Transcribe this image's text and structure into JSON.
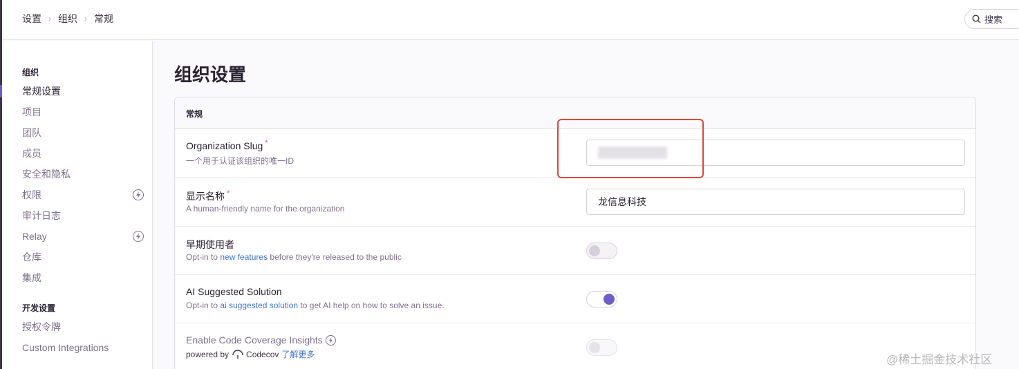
{
  "breadcrumb": [
    "设置",
    "组织",
    "常规"
  ],
  "search": {
    "label": "搜索"
  },
  "sidebar": {
    "section_org": "组织",
    "org_items": [
      {
        "label": "常规设置",
        "active": true,
        "badge": false
      },
      {
        "label": "项目",
        "active": false,
        "badge": false
      },
      {
        "label": "团队",
        "active": false,
        "badge": false
      },
      {
        "label": "成员",
        "active": false,
        "badge": false
      },
      {
        "label": "安全和隐私",
        "active": false,
        "badge": false
      },
      {
        "label": "权限",
        "active": false,
        "badge": true
      },
      {
        "label": "审计日志",
        "active": false,
        "badge": false
      },
      {
        "label": "Relay",
        "active": false,
        "badge": true
      },
      {
        "label": "仓库",
        "active": false,
        "badge": false
      },
      {
        "label": "集成",
        "active": false,
        "badge": false
      }
    ],
    "section_dev": "开发设置",
    "dev_items": [
      {
        "label": "授权令牌"
      },
      {
        "label": "Custom Integrations"
      }
    ]
  },
  "main": {
    "title": "组织设置",
    "panel_title": "常规",
    "fields": {
      "slug": {
        "label": "Organization Slug",
        "required": "*",
        "help": "一个用于认证该组织的唯一ID",
        "value": ""
      },
      "name": {
        "label": "显示名称",
        "required": "*",
        "help": "A human-friendly name for the organization",
        "value": "龙信息科技"
      },
      "early": {
        "label": "早期使用者",
        "help_pre": "Opt-in to ",
        "help_link": "new features",
        "help_post": " before they're released to the public",
        "enabled": false
      },
      "ai": {
        "label": "AI Suggested Solution",
        "help_pre": "Opt-in to ",
        "help_link": "ai suggested solution",
        "help_post": " to get AI help on how to solve an issue.",
        "enabled": true
      },
      "coverage": {
        "label": "Enable Code Coverage Insights",
        "help_pre": "powered by",
        "help_brand": "Codecov",
        "help_link": "了解更多",
        "enabled": false
      }
    }
  },
  "watermark": "@稀土掘金技术社区",
  "colors": {
    "accent": "#6c5fc7",
    "link": "#3d74db",
    "highlight": "#e0453a"
  }
}
